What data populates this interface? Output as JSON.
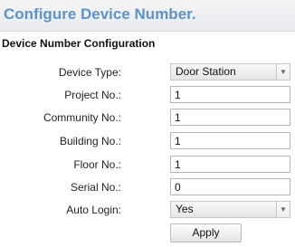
{
  "header": {
    "title": "Configure Device Number."
  },
  "section": {
    "title": "Device Number Configuration"
  },
  "fields": {
    "device_type": {
      "label": "Device Type:",
      "value": "Door Station"
    },
    "project_no": {
      "label": "Project No.:",
      "value": "1"
    },
    "community_no": {
      "label": "Community No.:",
      "value": "1"
    },
    "building_no": {
      "label": "Building No.:",
      "value": "1"
    },
    "floor_no": {
      "label": "Floor No.:",
      "value": "1"
    },
    "serial_no": {
      "label": "Serial No.:",
      "value": "0"
    },
    "auto_login": {
      "label": "Auto Login:",
      "value": "Yes"
    }
  },
  "actions": {
    "apply_label": "Apply"
  },
  "icons": {
    "dropdown": "chevron-down-icon"
  }
}
